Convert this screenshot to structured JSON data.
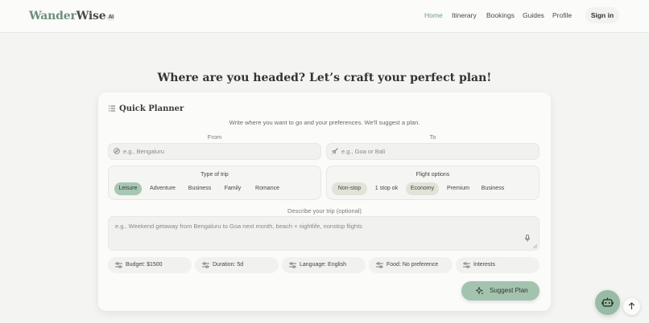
{
  "header": {
    "logo": {
      "main": "Wander",
      "accent": "Wise",
      "badge": "AI"
    },
    "nav": [
      "Home",
      "Itinerary",
      "Bookings",
      "Guides",
      "Profile"
    ],
    "active_nav": "Home",
    "signin_label": "Sign in"
  },
  "headline": "Where are you headed? Let’s craft your perfect plan!",
  "planner": {
    "title": "Quick Planner",
    "subtitle": "Write where you want to go and your preferences. We'll suggest a plan.",
    "from": {
      "label": "From",
      "placeholder": "e.g., Bengaluru"
    },
    "to": {
      "label": "To",
      "placeholder": "e.g., Goa or Bali"
    },
    "trip_type": {
      "title": "Type of trip",
      "options": [
        "Leisure",
        "Adventure",
        "Business",
        "Family",
        "Romance"
      ],
      "selected": "Leisure"
    },
    "flight_options": {
      "title": "Flight options",
      "options": [
        "Non-stop",
        "1 stop ok",
        "Economy",
        "Premium",
        "Business"
      ],
      "selected": [
        "Non-stop",
        "Economy"
      ]
    },
    "description": {
      "label": "Describe your trip (optional)",
      "placeholder": "e.g., Weekend getaway from Bengaluru to Goa next month, beach + nightlife, nonstop flights"
    },
    "preferences": [
      "Budget: $1500",
      "Duration: 5d",
      "Language: English",
      "Food: No preference",
      "Interests"
    ],
    "suggest_label": "Suggest Plan"
  },
  "colors": {
    "accent": "#a3c3ae",
    "accent_text": "#6d9f84",
    "background": "#f4f4f2"
  },
  "icons": {
    "planner": "list-icon",
    "from": "compass-icon",
    "to": "plane-icon",
    "preference": "sliders-icon",
    "textarea": "mic-icon",
    "suggest": "sparkle-icon",
    "assistant": "robot-icon",
    "scroll": "arrow-up-icon"
  }
}
